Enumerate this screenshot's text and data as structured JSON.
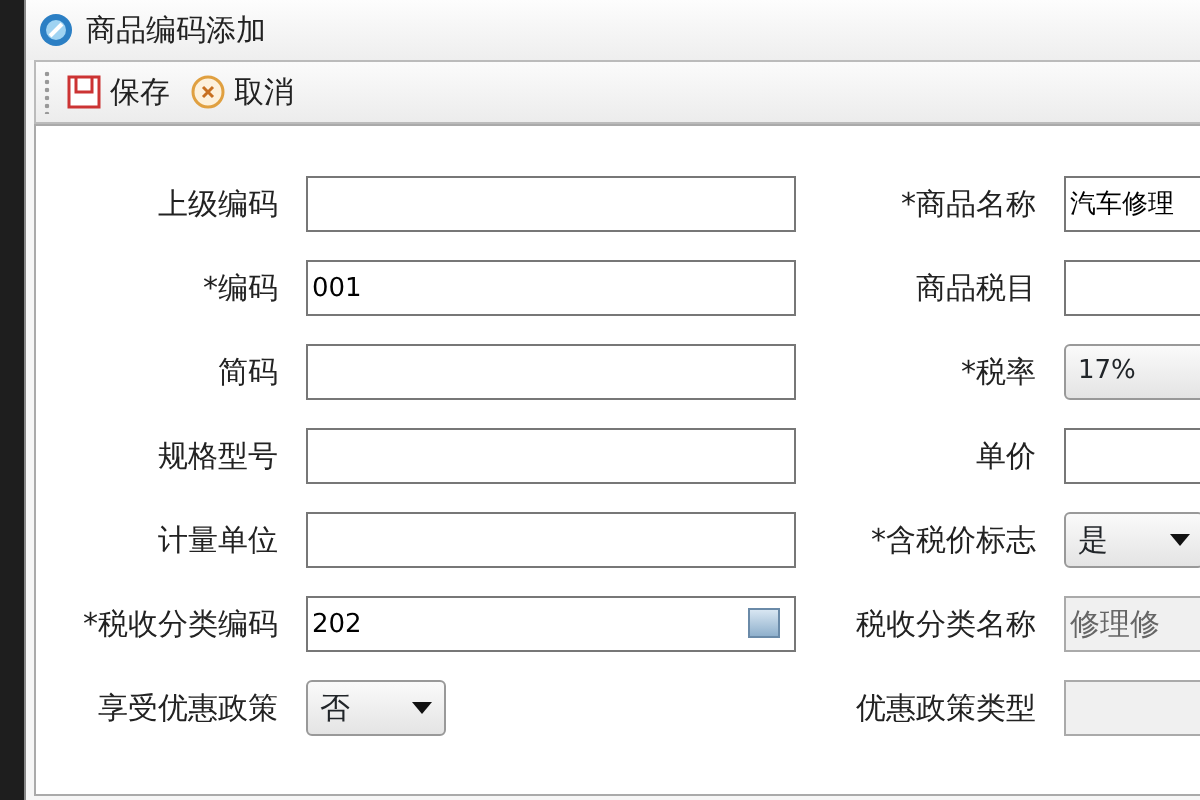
{
  "window": {
    "title": "商品编码添加"
  },
  "toolbar": [
    {
      "kind": "save",
      "label": "保存"
    },
    {
      "kind": "cancel",
      "label": "取消"
    }
  ],
  "form": [
    {
      "label": "上级编码",
      "kind": "text",
      "disabled": false
    },
    {
      "label": "*商品名称",
      "kind": "text",
      "value": "汽车修理",
      "disabled": false
    },
    {
      "label": "*编码",
      "kind": "text",
      "value": "001",
      "disabled": false
    },
    {
      "label": "商品税目",
      "kind": "text",
      "disabled": false
    },
    {
      "label": "简码",
      "kind": "text",
      "disabled": false
    },
    {
      "label": "*税率",
      "kind": "combo",
      "value": "17%",
      "disabled": false
    },
    {
      "label": "规格型号",
      "kind": "text",
      "disabled": false
    },
    {
      "label": "单价",
      "kind": "text",
      "disabled": false
    },
    {
      "label": "计量单位",
      "kind": "text",
      "disabled": false
    },
    {
      "label": "*含税价标志",
      "kind": "select",
      "value": "是",
      "disabled": false
    },
    {
      "label": "*税收分类编码",
      "kind": "lookup",
      "value": "202",
      "disabled": false
    },
    {
      "label": "税收分类名称",
      "kind": "text",
      "value": "修理修",
      "disabled": true
    },
    {
      "label": "享受优惠政策",
      "kind": "select",
      "value": "否",
      "disabled": false
    },
    {
      "label": "优惠政策类型",
      "kind": "text",
      "disabled": true
    }
  ]
}
